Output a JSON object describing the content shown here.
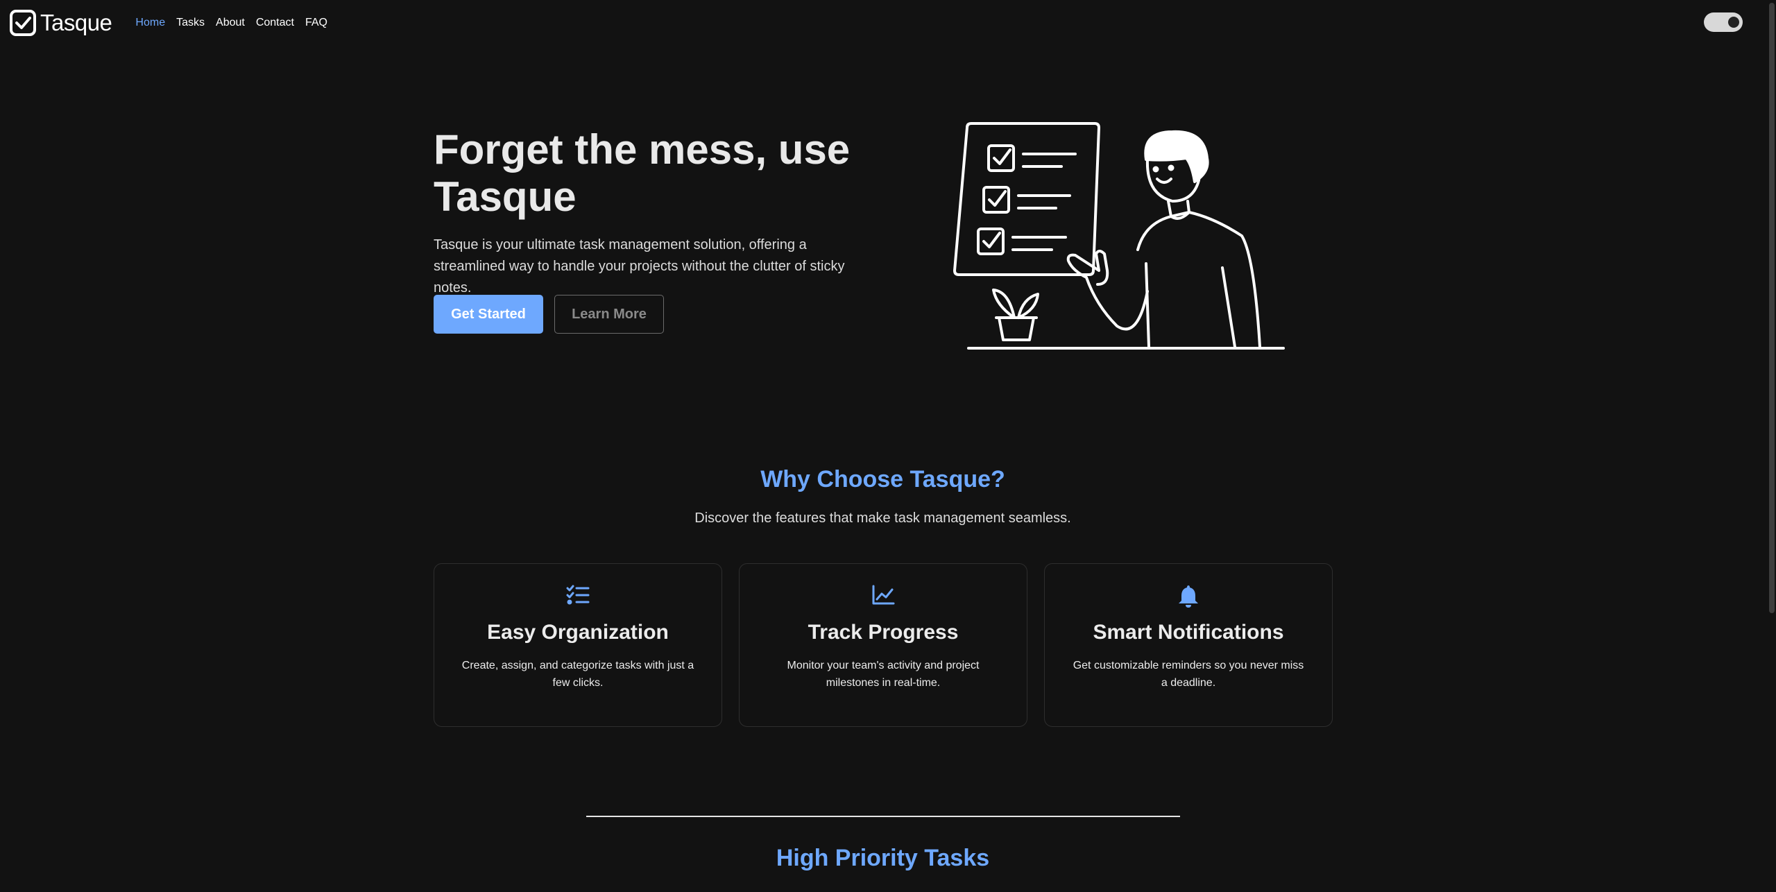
{
  "nav": {
    "brand": "Tasque",
    "links": [
      "Home",
      "Tasks",
      "About",
      "Contact",
      "FAQ"
    ]
  },
  "hero": {
    "title": "Forget the mess, use Tasque",
    "text": "Tasque is your ultimate task management solution, offering a streamlined way to handle your projects without the clutter of sticky notes.",
    "primary_button": "Get Started",
    "secondary_button": "Learn More"
  },
  "features": {
    "title": "Why Choose Tasque?",
    "subtitle": "Discover the features that make task management seamless.",
    "cards": [
      {
        "icon": "list-check-icon",
        "title": "Easy Organization",
        "text": "Create, assign, and categorize tasks with just a few clicks."
      },
      {
        "icon": "chart-line-icon",
        "title": "Track Progress",
        "text": "Monitor your team's activity and project milestones in real-time."
      },
      {
        "icon": "bell-icon",
        "title": "Smart Notifications",
        "text": "Get customizable reminders so you never miss a deadline."
      }
    ]
  },
  "priority": {
    "title": "High Priority Tasks"
  },
  "colors": {
    "accent": "#6ea8fe",
    "background": "#121212"
  }
}
